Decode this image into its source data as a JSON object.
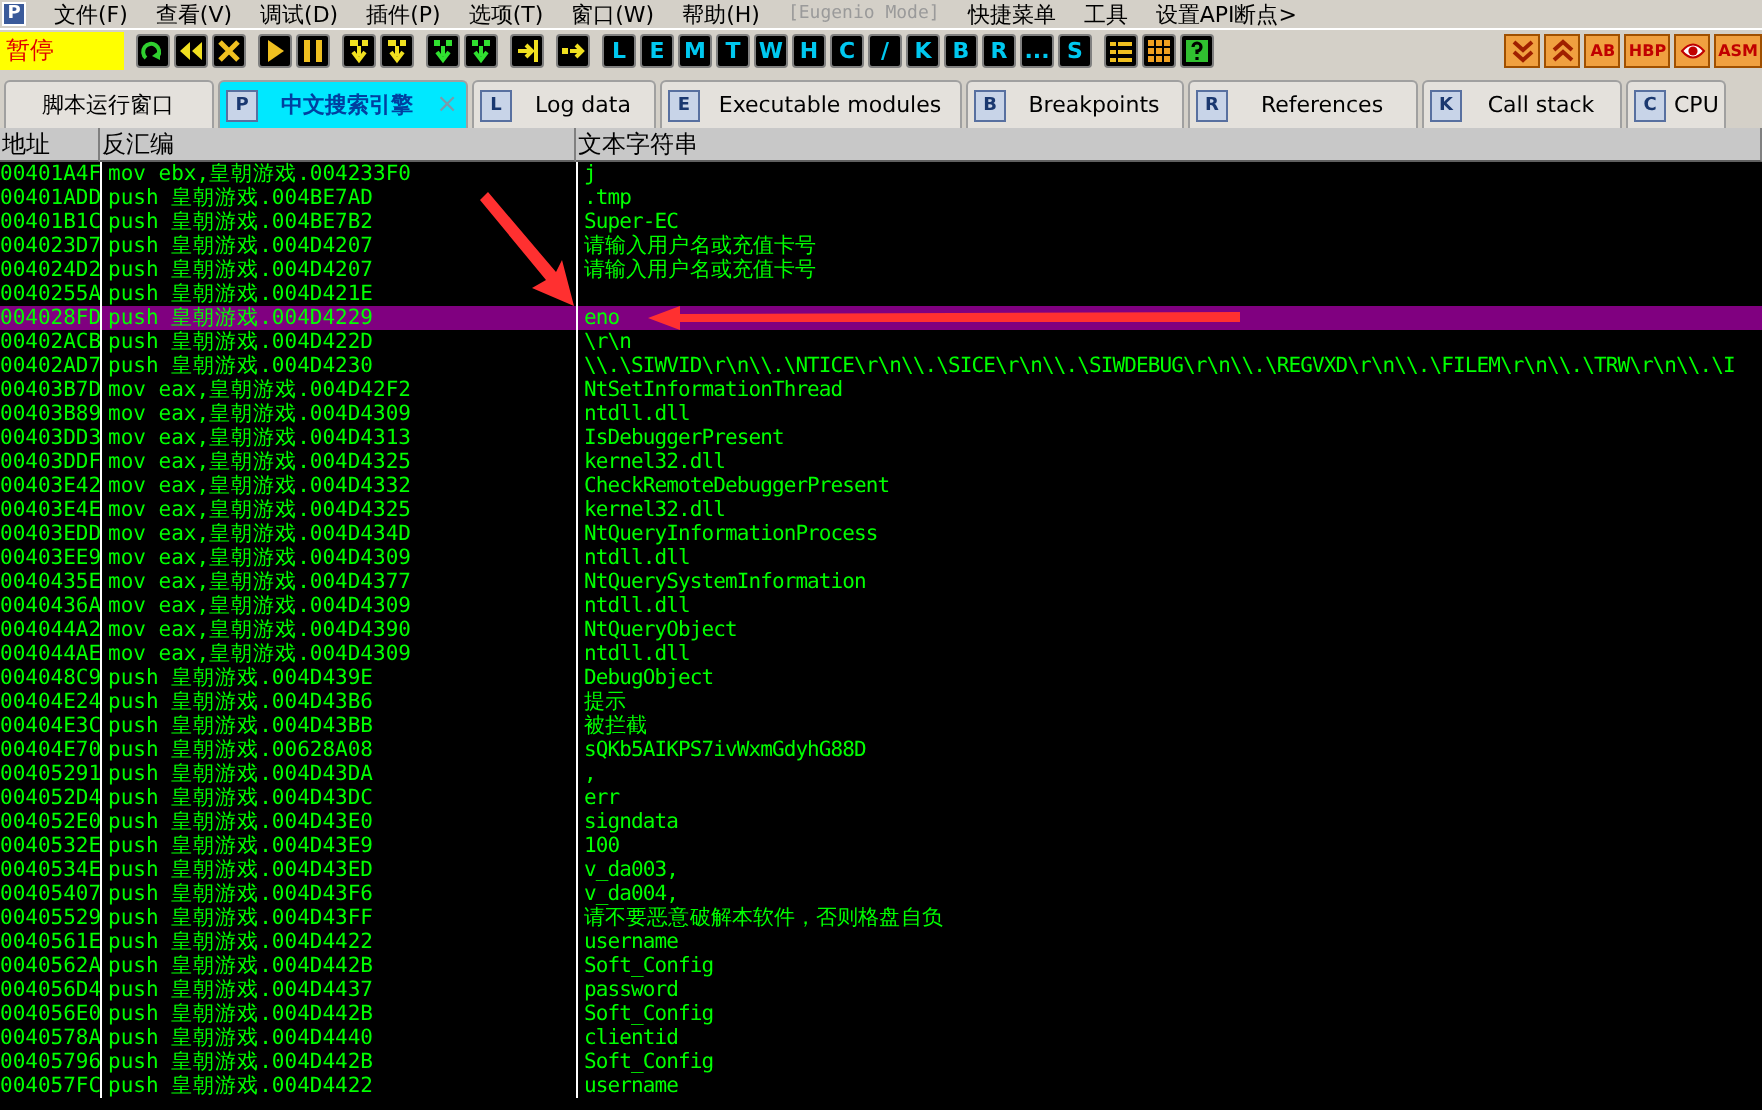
{
  "menu": {
    "logo": "P",
    "items": [
      {
        "label": "文件(F)",
        "disabled": false
      },
      {
        "label": "查看(V)",
        "disabled": false
      },
      {
        "label": "调试(D)",
        "disabled": false
      },
      {
        "label": "插件(P)",
        "disabled": false
      },
      {
        "label": "选项(T)",
        "disabled": false
      },
      {
        "label": "窗口(W)",
        "disabled": false
      },
      {
        "label": "帮助(H)",
        "disabled": false
      },
      {
        "label": "[Eugenio Mode]",
        "disabled": true
      },
      {
        "label": "快捷菜单",
        "disabled": false
      },
      {
        "label": "工具",
        "disabled": false
      },
      {
        "label": "设置API断点>",
        "disabled": false
      }
    ]
  },
  "toolbar": {
    "status": "暂停",
    "groups": [
      [
        {
          "kind": "icon"
        },
        {
          "kind": "icon"
        },
        {
          "kind": "icon"
        }
      ],
      [
        {
          "kind": "icon"
        },
        {
          "kind": "icon"
        }
      ],
      [
        {
          "kind": "icon"
        },
        {
          "kind": "icon"
        }
      ],
      [
        {
          "kind": "icon"
        },
        {
          "kind": "icon"
        }
      ],
      [
        {
          "kind": "icon"
        }
      ],
      [
        {
          "kind": "icon"
        }
      ],
      [
        {
          "kind": "letter",
          "label": "L"
        },
        {
          "kind": "letter",
          "label": "E"
        },
        {
          "kind": "letter",
          "label": "M"
        },
        {
          "kind": "letter",
          "label": "T"
        },
        {
          "kind": "letter",
          "label": "W"
        },
        {
          "kind": "letter",
          "label": "H"
        },
        {
          "kind": "letter",
          "label": "C"
        },
        {
          "kind": "letter",
          "label": "/"
        },
        {
          "kind": "letter",
          "label": "K"
        },
        {
          "kind": "letter",
          "label": "B"
        },
        {
          "kind": "letter",
          "label": "R"
        },
        {
          "kind": "letter",
          "label": "..."
        },
        {
          "kind": "letter",
          "label": "S"
        }
      ],
      [
        {
          "kind": "icon"
        },
        {
          "kind": "icon"
        },
        {
          "kind": "icon"
        }
      ]
    ],
    "plugins": [
      {
        "kind": "icon"
      },
      {
        "kind": "icon"
      },
      {
        "kind": "text",
        "label": "AB"
      },
      {
        "kind": "text",
        "label": "HBP"
      },
      {
        "kind": "icon"
      },
      {
        "kind": "text",
        "label": "ASM"
      }
    ]
  },
  "tabs": [
    {
      "label": "脚本运行窗口",
      "selected": false
    },
    {
      "icon": "P",
      "label": "中文搜索引擎",
      "selected": true,
      "close": "×"
    },
    {
      "icon": "L",
      "label": "Log data",
      "selected": false
    },
    {
      "icon": "E",
      "label": "Executable modules",
      "selected": false
    },
    {
      "icon": "B",
      "label": "Breakpoints",
      "selected": false
    },
    {
      "icon": "R",
      "label": "References",
      "selected": false
    },
    {
      "icon": "K",
      "label": "Call stack",
      "selected": false
    },
    {
      "icon": "C",
      "label": "CPU",
      "selected": false
    }
  ],
  "table": {
    "columns": [
      "地址",
      "反汇编",
      "文本字符串"
    ],
    "rows": [
      {
        "address": "00401A4F",
        "disasm": "mov ebx,皇朝游戏.004233F0",
        "text": "j",
        "selected": false
      },
      {
        "address": "00401ADD",
        "disasm": "push 皇朝游戏.004BE7AD",
        "text": ".tmp",
        "selected": false
      },
      {
        "address": "00401B1C",
        "disasm": "push 皇朝游戏.004BE7B2",
        "text": "Super-EC",
        "selected": false
      },
      {
        "address": "004023D7",
        "disasm": "push 皇朝游戏.004D4207",
        "text": "请输入用户名或充值卡号",
        "selected": false
      },
      {
        "address": "004024D2",
        "disasm": "push 皇朝游戏.004D4207",
        "text": "请输入用户名或充值卡号",
        "selected": false
      },
      {
        "address": "0040255A",
        "disasm": "push 皇朝游戏.004D421E",
        "selected": false
      },
      {
        "address": "004028FD",
        "disasm": "push 皇朝游戏.004D4229",
        "text": "eno",
        "selected": true
      },
      {
        "address": "00402ACB",
        "disasm": "push 皇朝游戏.004D422D",
        "text": "\\r\\n",
        "selected": false
      },
      {
        "address": "00402AD7",
        "disasm": "push 皇朝游戏.004D4230",
        "text": "\\\\.\\SIWVID\\r\\n\\\\.\\NTICE\\r\\n\\\\.\\SICE\\r\\n\\\\.\\SIWDEBUG\\r\\n\\\\.\\REGVXD\\r\\n\\\\.\\FILEM\\r\\n\\\\.\\TRW\\r\\n\\\\.\\I",
        "selected": false
      },
      {
        "address": "00403B7D",
        "disasm": "mov eax,皇朝游戏.004D42F2",
        "text": "NtSetInformationThread",
        "selected": false
      },
      {
        "address": "00403B89",
        "disasm": "mov eax,皇朝游戏.004D4309",
        "text": "ntdll.dll",
        "selected": false
      },
      {
        "address": "00403DD3",
        "disasm": "mov eax,皇朝游戏.004D4313",
        "text": "IsDebuggerPresent",
        "selected": false
      },
      {
        "address": "00403DDF",
        "disasm": "mov eax,皇朝游戏.004D4325",
        "text": "kernel32.dll",
        "selected": false
      },
      {
        "address": "00403E42",
        "disasm": "mov eax,皇朝游戏.004D4332",
        "text": "CheckRemoteDebuggerPresent",
        "selected": false
      },
      {
        "address": "00403E4E",
        "disasm": "mov eax,皇朝游戏.004D4325",
        "text": "kernel32.dll",
        "selected": false
      },
      {
        "address": "00403EDD",
        "disasm": "mov eax,皇朝游戏.004D434D",
        "text": "NtQueryInformationProcess",
        "selected": false
      },
      {
        "address": "00403EE9",
        "disasm": "mov eax,皇朝游戏.004D4309",
        "text": "ntdll.dll",
        "selected": false
      },
      {
        "address": "0040435E",
        "disasm": "mov eax,皇朝游戏.004D4377",
        "text": "NtQuerySystemInformation",
        "selected": false
      },
      {
        "address": "0040436A",
        "disasm": "mov eax,皇朝游戏.004D4309",
        "text": "ntdll.dll",
        "selected": false
      },
      {
        "address": "004044A2",
        "disasm": "mov eax,皇朝游戏.004D4390",
        "text": "NtQueryObject",
        "selected": false
      },
      {
        "address": "004044AE",
        "disasm": "mov eax,皇朝游戏.004D4309",
        "text": "ntdll.dll",
        "selected": false
      },
      {
        "address": "004048C9",
        "disasm": "push 皇朝游戏.004D439E",
        "text": "DebugObject",
        "selected": false
      },
      {
        "address": "00404E24",
        "disasm": "push 皇朝游戏.004D43B6",
        "text": "提示",
        "selected": false
      },
      {
        "address": "00404E3C",
        "disasm": "push 皇朝游戏.004D43BB",
        "text": "被拦截",
        "selected": false
      },
      {
        "address": "00404E70",
        "disasm": "push 皇朝游戏.00628A08",
        "text": "sQKb5AIKPS7ivWxmGdyhG88D",
        "selected": false
      },
      {
        "address": "00405291",
        "disasm": "push 皇朝游戏.004D43DA",
        "text": ",",
        "selected": false
      },
      {
        "address": "004052D4",
        "disasm": "push 皇朝游戏.004D43DC",
        "text": "err",
        "selected": false
      },
      {
        "address": "004052E0",
        "disasm": "push 皇朝游戏.004D43E0",
        "text": "signdata",
        "selected": false
      },
      {
        "address": "0040532E",
        "disasm": "push 皇朝游戏.004D43E9",
        "text": "100",
        "selected": false
      },
      {
        "address": "0040534E",
        "disasm": "push 皇朝游戏.004D43ED",
        "text": "v_da003,",
        "selected": false
      },
      {
        "address": "00405407",
        "disasm": "push 皇朝游戏.004D43F6",
        "text": "v_da004,",
        "selected": false
      },
      {
        "address": "00405529",
        "disasm": "push 皇朝游戏.004D43FF",
        "text": "请不要恶意破解本软件，否则格盘自负",
        "selected": false
      },
      {
        "address": "0040561E",
        "disasm": "push 皇朝游戏.004D4422",
        "text": "username",
        "selected": false
      },
      {
        "address": "0040562A",
        "disasm": "push 皇朝游戏.004D442B",
        "text": "Soft_Config",
        "selected": false
      },
      {
        "address": "004056D4",
        "disasm": "push 皇朝游戏.004D4437",
        "text": "password",
        "selected": false
      },
      {
        "address": "004056E0",
        "disasm": "push 皇朝游戏.004D442B",
        "text": "Soft_Config",
        "selected": false
      },
      {
        "address": "0040578A",
        "disasm": "push 皇朝游戏.004D4440",
        "text": "clientid",
        "selected": false
      },
      {
        "address": "00405796",
        "disasm": "push 皇朝游戏.004D442B",
        "text": "Soft_Config",
        "selected": false
      },
      {
        "address": "004057FC",
        "disasm": "push 皇朝游戏.004D4422",
        "text": "username",
        "selected": false
      }
    ]
  }
}
